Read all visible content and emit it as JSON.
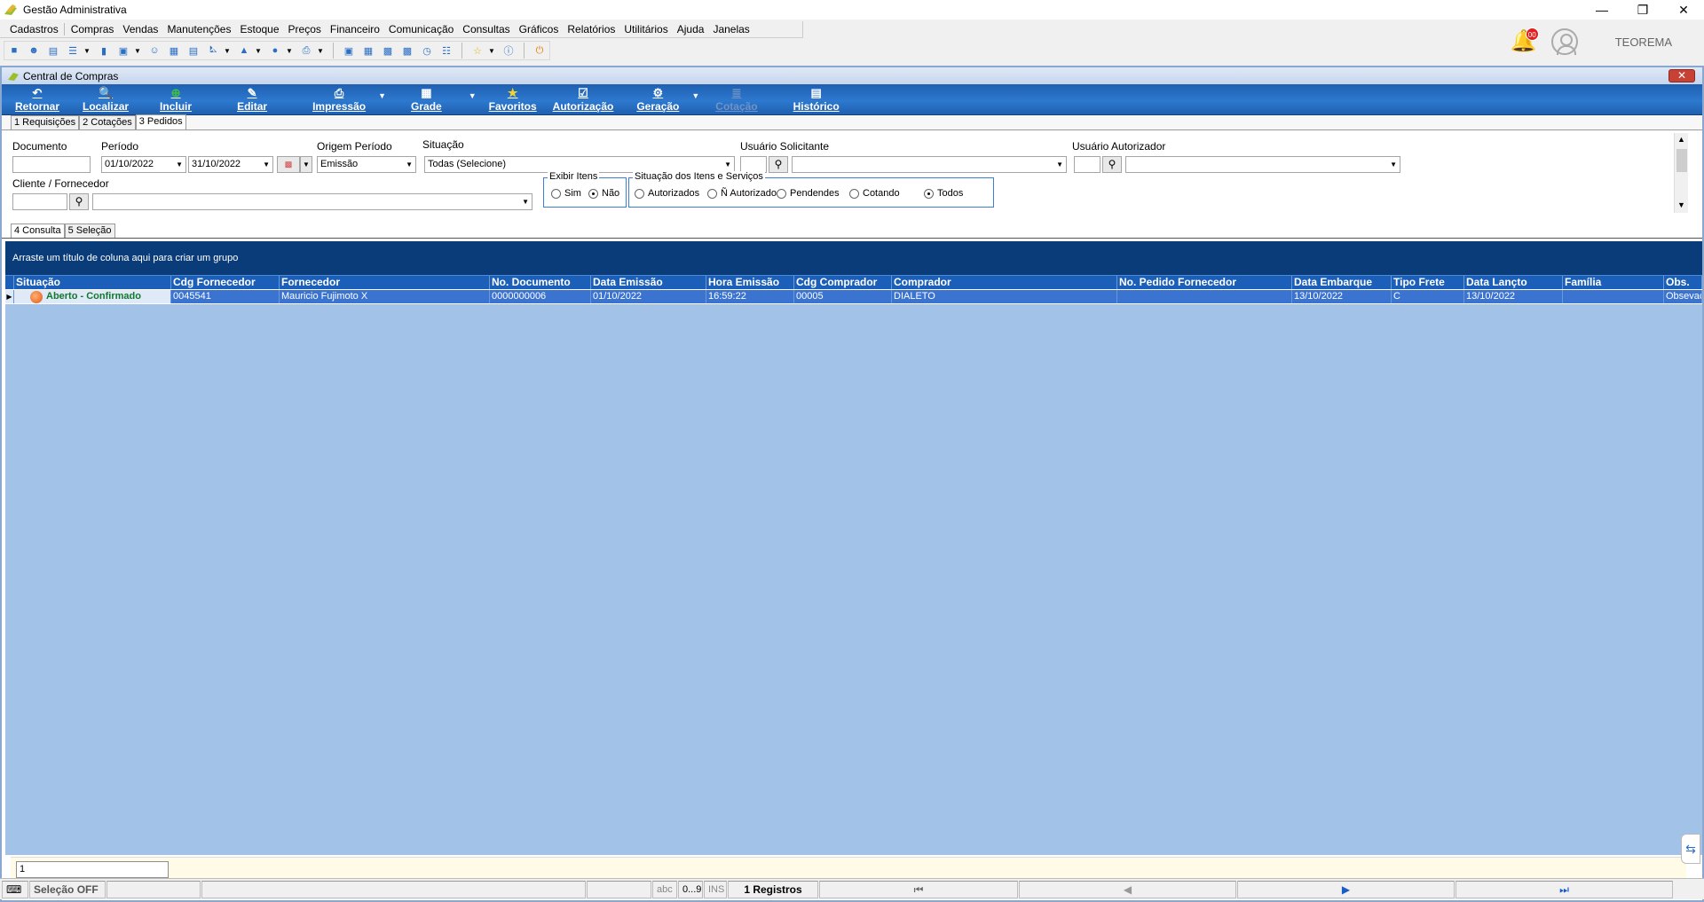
{
  "window": {
    "title": "Gestão Administrativa"
  },
  "menu": [
    "Cadastros",
    "Compras",
    "Vendas",
    "Manutenções",
    "Estoque",
    "Preços",
    "Financeiro",
    "Comunicação",
    "Consultas",
    "Gráficos",
    "Relatórios",
    "Utilitários",
    "Ajuda",
    "Janelas"
  ],
  "header": {
    "notification_count": "00",
    "company": "TEOREMA"
  },
  "child": {
    "title": "Central de Compras",
    "actions": [
      {
        "label": "Retornar",
        "icon": "↶"
      },
      {
        "label": "Localizar",
        "icon": "🔍"
      },
      {
        "label": "Incluir",
        "icon": "⊕"
      },
      {
        "label": "Editar",
        "icon": "✎"
      },
      {
        "label": "Impressão",
        "icon": "⎙"
      },
      {
        "label": "Grade",
        "icon": "▦"
      },
      {
        "label": "Favoritos",
        "icon": "★"
      },
      {
        "label": "Autorização",
        "icon": "☑"
      },
      {
        "label": "Geração",
        "icon": "⚙"
      },
      {
        "label": "Cotação",
        "icon": "≣"
      },
      {
        "label": "Histórico",
        "icon": "▤"
      }
    ],
    "tabs": [
      "1 Requisições",
      "2 Cotações",
      "3 Pedidos"
    ],
    "active_tab": "3 Pedidos"
  },
  "filters": {
    "documento_label": "Documento",
    "documento_value": "",
    "periodo_label": "Período",
    "periodo_start": "01/10/2022",
    "periodo_end": "31/10/2022",
    "origem_label": "Origem Período",
    "origem_value": "Emissão",
    "situacao_label": "Situação",
    "situacao_value": "Todas (Selecione)",
    "usuario_solicitante_label": "Usuário Solicitante",
    "usuario_autorizador_label": "Usuário Autorizador",
    "cliente_label": "Cliente / Fornecedor",
    "exibir_itens_label": "Exibir Itens",
    "exibir_sim": "Sim",
    "exibir_nao": "Não",
    "exibir_selected": "Não",
    "situacao_itens_label": "Situação dos Itens e Serviços",
    "situacao_itens_options": [
      "Autorizados",
      "Ñ Autorizado",
      "Pendendes",
      "Cotando",
      "Todos"
    ],
    "situacao_itens_selected": "Todos"
  },
  "subtabs": [
    "4 Consulta",
    "5 Seleção"
  ],
  "grid": {
    "group_hint": "Arraste um título de coluna aqui para criar um grupo",
    "columns": [
      "Situação",
      "Cdg Fornecedor",
      "Fornecedor",
      "No. Documento",
      "Data Emissão",
      "Hora Emissão",
      "Cdg Comprador",
      "Comprador",
      "No. Pedido Fornecedor",
      "Data Embarque",
      "Tipo Frete",
      "Data Lançto",
      "Família",
      "Obs."
    ],
    "rows": [
      [
        "Aberto - Confirmado",
        "0045541",
        "Mauricio Fujimoto X",
        "0000000006",
        "01/10/2022",
        "16:59:22",
        "00005",
        "DIALETO",
        "",
        "13/10/2022",
        "C",
        "13/10/2022",
        "",
        "Obsevação"
      ]
    ]
  },
  "footer": {
    "input_value": "1"
  },
  "statusbar": {
    "selecao": "Seleção OFF",
    "abc": "abc",
    "num": "0...9",
    "ins": "INS",
    "registros": "1 Registros"
  }
}
